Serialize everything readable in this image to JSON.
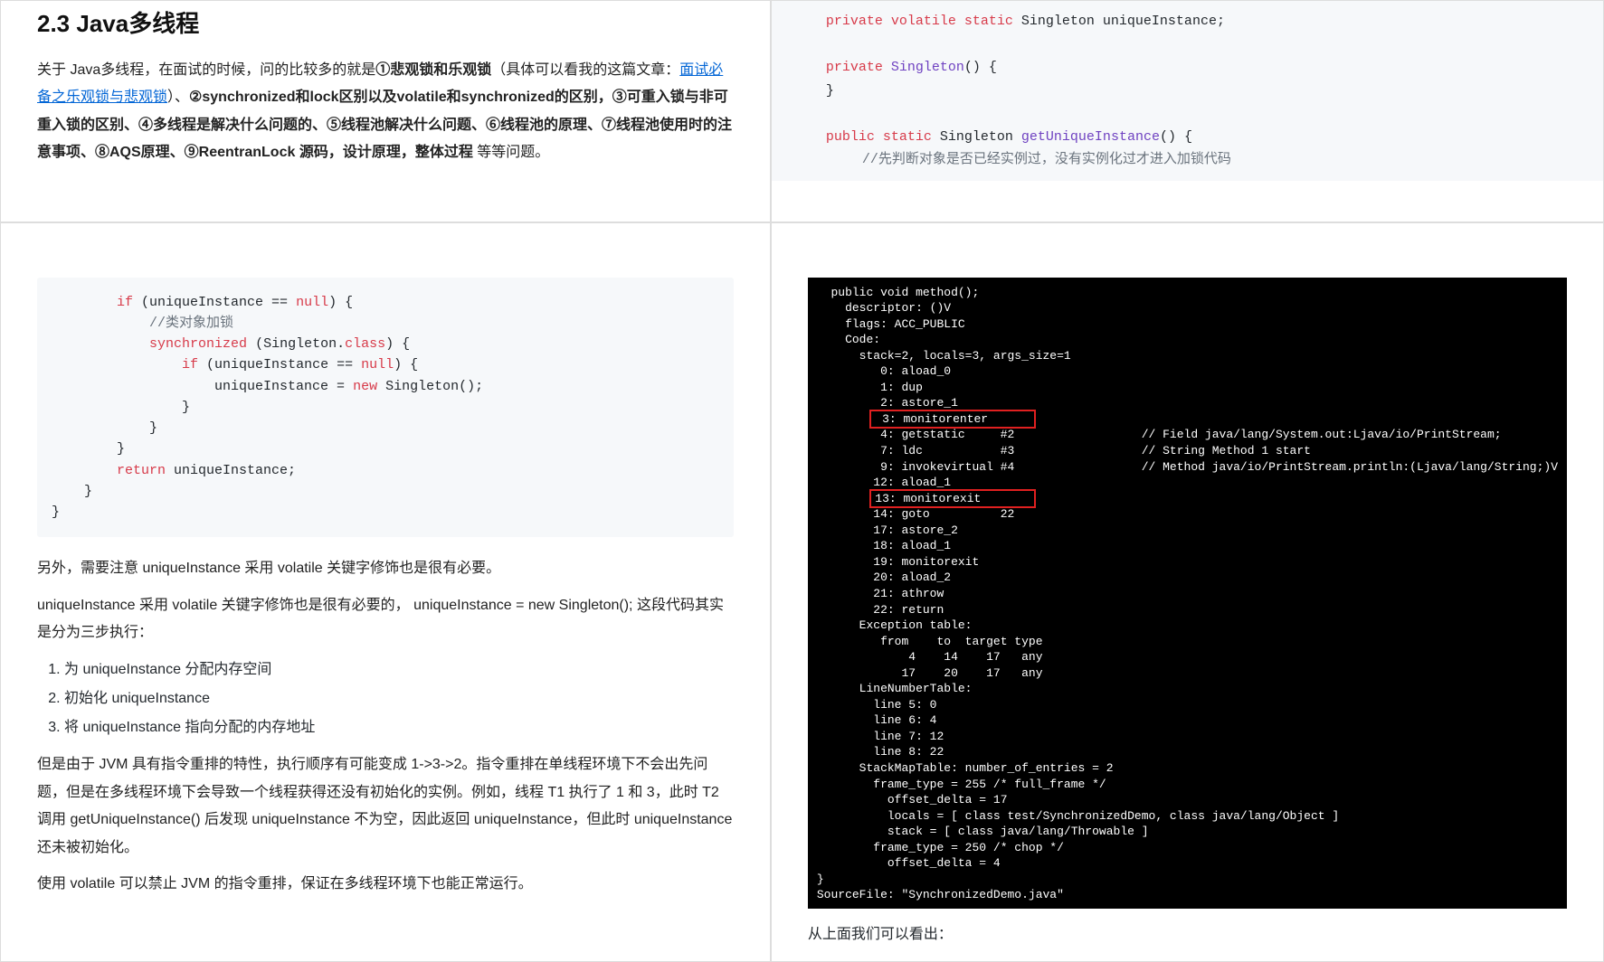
{
  "tl": {
    "heading": "2.3 Java多线程",
    "intro_a": "关于 Java多线程，在面试的时候，问的比较多的就是",
    "b1": "①悲观锁和乐观锁",
    "intro_b": "（具体可以看我的这篇文章：",
    "link": "面试必备之乐观锁与悲观锁",
    "intro_c": "）、",
    "b2": "②synchronized和lock区别以及volatile和synchronized的区别，③可重入锁与非可重入锁的区别、④多线程是解决什么问题的、⑤线程池解决什么问题、⑥线程池的原理、⑦线程池使用时的注意事项、⑧AQS原理、⑨ReentranLock 源码，设计原理，整体过程",
    "intro_d": " 等等问题。"
  },
  "tr": {
    "l1a": "private volatile static",
    "l1b": " Singleton uniqueInstance;",
    "l2a": "private",
    "l2b": " Singleton",
    "l2c": "() {",
    "l3": "}",
    "l4a": "public static",
    "l4b": " Singleton ",
    "l4c": "getUniqueInstance",
    "l4d": "() {",
    "l5": "//先判断对象是否已经实例过，没有实例化过才进入加锁代码"
  },
  "bl": {
    "code": {
      "l1a": "if",
      "l1b": " (uniqueInstance == ",
      "l1c": "null",
      "l1d": ") {",
      "l2": "//类对象加锁",
      "l3a": "synchronized",
      "l3b": " (Singleton.",
      "l3c": "class",
      "l3d": ") {",
      "l4a": "if",
      "l4b": " (uniqueInstance == ",
      "l4c": "null",
      "l4d": ") {",
      "l5a": "uniqueInstance = ",
      "l5b": "new",
      "l5c": " Singleton();",
      "l6": "}",
      "l7": "}",
      "l8": "}",
      "l9a": "return",
      "l9b": " uniqueInstance;",
      "l10": "}",
      "l11": "}"
    },
    "p1": "另外，需要注意 uniqueInstance 采用 volatile 关键字修饰也是很有必要。",
    "p2": "uniqueInstance 采用 volatile 关键字修饰也是很有必要的， uniqueInstance = new Singleton(); 这段代码其实是分为三步执行：",
    "li1": "为 uniqueInstance 分配内存空间",
    "li2": "初始化 uniqueInstance",
    "li3": "将 uniqueInstance 指向分配的内存地址",
    "p3": "但是由于 JVM 具有指令重排的特性，执行顺序有可能变成 1->3->2。指令重排在单线程环境下不会出先问题，但是在多线程环境下会导致一个线程获得还没有初始化的实例。例如，线程 T1 执行了 1 和 3，此时 T2 调用 getUniqueInstance() 后发现 uniqueInstance 不为空，因此返回 uniqueInstance，但此时 uniqueInstance 还未被初始化。",
    "p4": "使用 volatile 可以禁止 JVM 的指令重排，保证在多线程环境下也能正常运行。"
  },
  "br": {
    "bc_head": "  public void method();\n    descriptor: ()V\n    flags: ACC_PUBLIC\n    Code:\n      stack=2, locals=3, args_size=1\n         0: aload_0\n         1: dup\n         2: astore_1",
    "bc_hl1": " 3: monitorenter      ",
    "bc_mid": "         4: getstatic     #2                  // Field java/lang/System.out:Ljava/io/PrintStream;\n         7: ldc           #3                  // String Method 1 start\n         9: invokevirtual #4                  // Method java/io/PrintStream.println:(Ljava/lang/String;)V\n        12: aload_1",
    "bc_hl2": "13: monitorexit       ",
    "bc_tail": "        14: goto          22\n        17: astore_2\n        18: aload_1\n        19: monitorexit\n        20: aload_2\n        21: athrow\n        22: return\n      Exception table:\n         from    to  target type\n             4    14    17   any\n            17    20    17   any\n      LineNumberTable:\n        line 5: 0\n        line 6: 4\n        line 7: 12\n        line 8: 22\n      StackMapTable: number_of_entries = 2\n        frame_type = 255 /* full_frame */\n          offset_delta = 17\n          locals = [ class test/SynchronizedDemo, class java/lang/Object ]\n          stack = [ class java/lang/Throwable ]\n        frame_type = 250 /* chop */\n          offset_delta = 4\n}\nSourceFile: \"SynchronizedDemo.java\"",
    "caption": "从上面我们可以看出："
  }
}
